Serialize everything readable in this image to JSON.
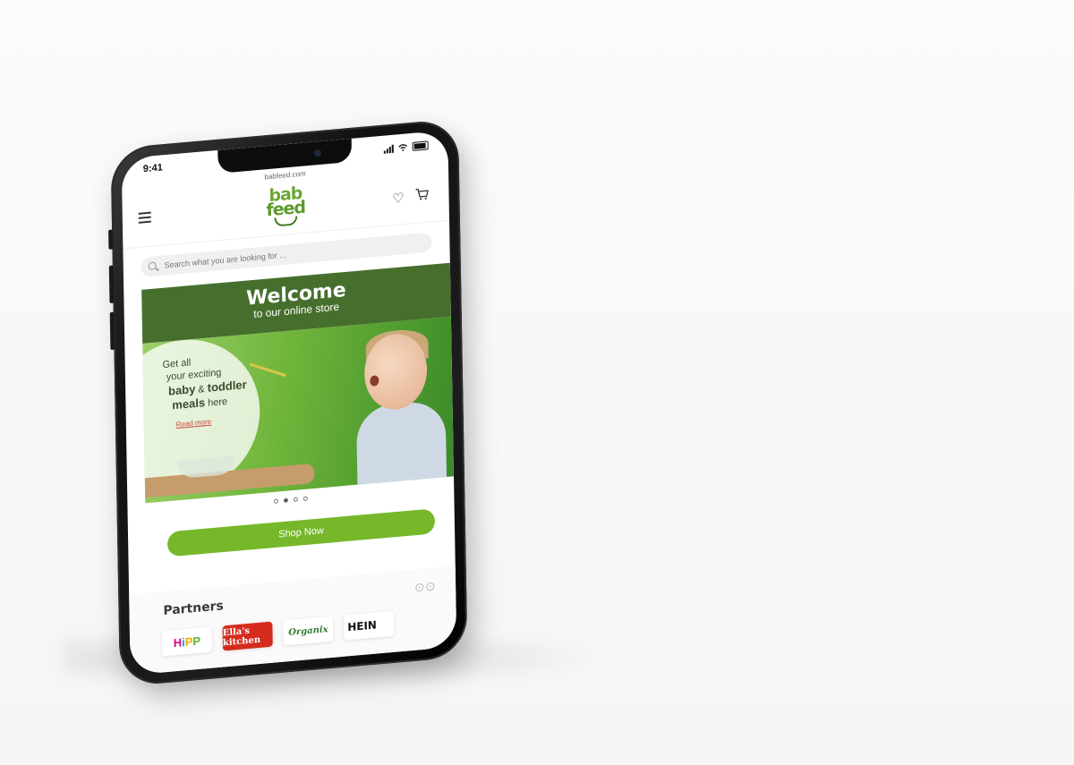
{
  "status": {
    "time": "9:41"
  },
  "browser": {
    "url": "babfeed.com"
  },
  "logo": {
    "line1": "bab",
    "line2": "feed"
  },
  "search": {
    "placeholder": "Search what you are looking for ..."
  },
  "welcome": {
    "title": "Welcome",
    "subtitle": "to our online store"
  },
  "hero": {
    "line1": "Get all",
    "line2": "your exciting",
    "line3_bold": "baby",
    "line3_amp": " & ",
    "line3_bold2": "toddler",
    "line4_bold": "meals",
    "line4_rest": " here",
    "read_more": "Read more"
  },
  "carousel": {
    "count": 4,
    "active_index": 1
  },
  "shop_button": {
    "label": "Shop Now"
  },
  "partners": {
    "title": "Partners",
    "prev": "‹",
    "next": "›",
    "brands": [
      "HiPP",
      "Ella's kitchen",
      "Organix",
      "HEIN"
    ]
  },
  "colors": {
    "brand_green": "#76b82a",
    "dark_green": "#466f2d"
  }
}
